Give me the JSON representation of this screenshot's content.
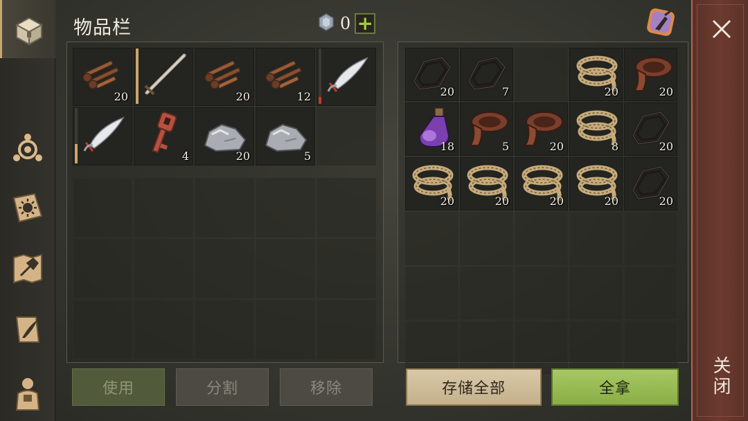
{
  "sidebar": {
    "tabs": [
      {
        "icon": "chest-icon",
        "active": true
      },
      {
        "icon": "clan-emblem-icon",
        "active": false
      },
      {
        "icon": "sun-book-icon",
        "active": false
      },
      {
        "icon": "hammer-map-icon",
        "active": false
      },
      {
        "icon": "quill-scroll-icon",
        "active": false
      },
      {
        "icon": "character-icon",
        "active": false
      }
    ]
  },
  "header": {
    "title": "物品栏",
    "currency_count": "0",
    "plus_label": "+"
  },
  "inventory": {
    "top_rows": [
      [
        {
          "item": "nails",
          "qty": "20"
        },
        {
          "item": "sword",
          "qty": "",
          "durability": 1.0,
          "durability_color": "#c9a66b"
        },
        {
          "item": "nails",
          "qty": "20"
        },
        {
          "item": "nails",
          "qty": "12"
        },
        {
          "item": "scimitar",
          "qty": "",
          "durability": 0.12,
          "durability_color": "#c0392b"
        }
      ],
      [
        {
          "item": "scimitar",
          "qty": "",
          "durability": 0.35,
          "durability_color": "#c9a66b"
        },
        {
          "item": "key",
          "qty": "4"
        },
        {
          "item": "stone",
          "qty": "20"
        },
        {
          "item": "stone",
          "qty": "5"
        },
        {
          "item": "",
          "qty": ""
        }
      ]
    ],
    "empty_rows": 3
  },
  "storage": {
    "rows": [
      [
        {
          "item": "wire",
          "qty": "20"
        },
        {
          "item": "wire",
          "qty": "7"
        },
        {
          "item": "",
          "qty": ""
        },
        {
          "item": "rope",
          "qty": "20"
        },
        {
          "item": "leather",
          "qty": "20"
        }
      ],
      [
        {
          "item": "potion",
          "qty": "18"
        },
        {
          "item": "leather",
          "qty": "5"
        },
        {
          "item": "leather",
          "qty": "20"
        },
        {
          "item": "rope",
          "qty": "8"
        },
        {
          "item": "wire",
          "qty": "20"
        }
      ],
      [
        {
          "item": "rope",
          "qty": "20"
        },
        {
          "item": "rope",
          "qty": "20"
        },
        {
          "item": "rope",
          "qty": "20"
        },
        {
          "item": "rope",
          "qty": "20"
        },
        {
          "item": "wire",
          "qty": "20"
        }
      ]
    ],
    "empty_rows": 3
  },
  "actions": {
    "use": "使用",
    "split": "分割",
    "remove": "移除",
    "store_all": "存储全部",
    "take_all": "全拿"
  },
  "close": {
    "label": "关闭"
  },
  "colors": {
    "accent_gold": "#c9a66b",
    "take_green": "#9bbd55",
    "close_red": "#6c3a2f",
    "plus_green": "#a5cc3a"
  }
}
